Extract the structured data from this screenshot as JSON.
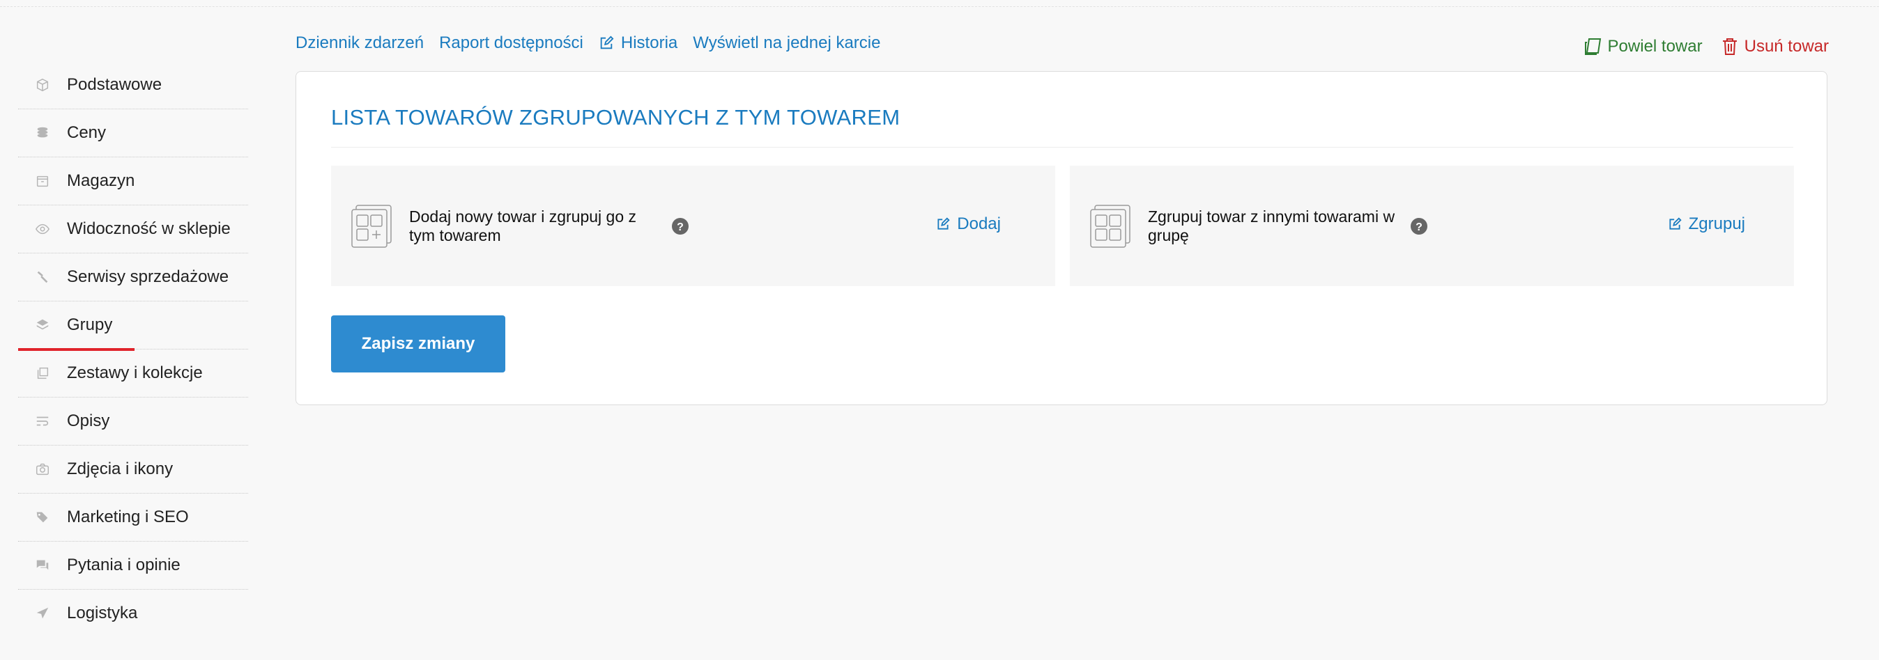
{
  "sidebar": {
    "items": [
      {
        "label": "Podstawowe",
        "icon": "box-icon"
      },
      {
        "label": "Ceny",
        "icon": "coins-icon"
      },
      {
        "label": "Magazyn",
        "icon": "storage-icon"
      },
      {
        "label": "Widoczność w sklepie",
        "icon": "eye-icon"
      },
      {
        "label": "Serwisy sprzedażowe",
        "icon": "hammer-icon"
      },
      {
        "label": "Grupy",
        "icon": "layers-icon",
        "active": true
      },
      {
        "label": "Zestawy i kolekcje",
        "icon": "collection-icon"
      },
      {
        "label": "Opisy",
        "icon": "text-wrap-icon"
      },
      {
        "label": "Zdjęcia i ikony",
        "icon": "camera-icon"
      },
      {
        "label": "Marketing i SEO",
        "icon": "tags-icon"
      },
      {
        "label": "Pytania i opinie",
        "icon": "comments-icon"
      },
      {
        "label": "Logistyka",
        "icon": "paper-plane-icon"
      }
    ]
  },
  "toplinks": {
    "event_log": "Dziennik zdarzeń",
    "availability_report": "Raport dostępności",
    "history": "Historia",
    "single_card": "Wyświetl na jednej karcie"
  },
  "actions": {
    "duplicate": "Powiel towar",
    "delete": "Usuń towar"
  },
  "card": {
    "title": "LISTA TOWARÓW ZGRUPOWANYCH Z TYM TOWAREM",
    "panels": [
      {
        "text": "Dodaj nowy towar i zgrupuj go z tym towarem",
        "action": "Dodaj"
      },
      {
        "text": "Zgrupuj towar z innymi towarami w grupę",
        "action": "Zgrupuj"
      }
    ],
    "save_label": "Zapisz zmiany"
  },
  "colors": {
    "accent": "#1a7bbf",
    "active_underline": "#e0232b",
    "duplicate": "#2e7d32",
    "delete": "#c62828"
  }
}
